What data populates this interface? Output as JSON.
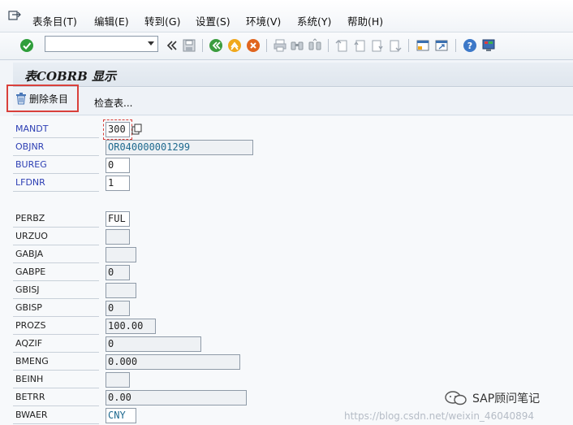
{
  "menubar": {
    "items": [
      {
        "label": "表条目(T)"
      },
      {
        "label": "编辑(E)"
      },
      {
        "label": "转到(G)"
      },
      {
        "label": "设置(S)"
      },
      {
        "label": "环境(V)"
      },
      {
        "label": "系统(Y)"
      },
      {
        "label": "帮助(H)"
      }
    ]
  },
  "toolbar": {
    "command_value": "",
    "icons": [
      "enter-check-icon",
      "command-dropdown-icon",
      "double-chevron-left-icon",
      "save-icon",
      "back-icon",
      "exit-icon",
      "cancel-icon",
      "print-icon",
      "find-icon",
      "find-next-icon",
      "first-page-icon",
      "previous-page-icon",
      "next-page-icon",
      "last-page-icon",
      "create-session-icon",
      "shortcut-icon",
      "help-icon",
      "customize-layout-icon"
    ]
  },
  "title": "表COBRB 显示",
  "app_toolbar": {
    "delete_label": "删除条目",
    "check_table_label": "检查表..."
  },
  "fields": [
    {
      "name": "MANDT",
      "value": "300",
      "key": true
    },
    {
      "name": "OBJNR",
      "value": "OR040000001299",
      "key": true
    },
    {
      "name": "BUREG",
      "value": "0",
      "key": true
    },
    {
      "name": "LFDNR",
      "value": "1",
      "key": true
    },
    {
      "name": "PERBZ",
      "value": "FUL",
      "key": false
    },
    {
      "name": "URZUO",
      "value": "",
      "key": false
    },
    {
      "name": "GABJA",
      "value": "",
      "key": false
    },
    {
      "name": "GABPE",
      "value": "0",
      "key": false
    },
    {
      "name": "GBISJ",
      "value": "",
      "key": false
    },
    {
      "name": "GBISP",
      "value": "0",
      "key": false
    },
    {
      "name": "PROZS",
      "value": "100.00",
      "key": false
    },
    {
      "name": "AQZIF",
      "value": "0",
      "key": false
    },
    {
      "name": "BMENG",
      "value": "0.000",
      "key": false
    },
    {
      "name": "BEINH",
      "value": "",
      "key": false
    },
    {
      "name": "BETRR",
      "value": "0.00",
      "key": false
    },
    {
      "name": "BWAER",
      "value": "CNY",
      "key": false
    }
  ],
  "watermark": "https://blog.csdn.net/weixin_46040894",
  "brand": "SAP顾问笔记",
  "colors": {
    "key_label": "#2d3fb4",
    "highlight": "#d9403b"
  }
}
